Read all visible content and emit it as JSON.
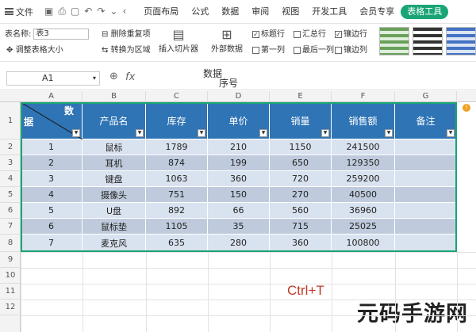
{
  "menubar": {
    "file_label": "文件",
    "tabs": [
      "页面布局",
      "公式",
      "数据",
      "审阅",
      "视图",
      "开发工具",
      "会员专享",
      "表格工具"
    ]
  },
  "ribbon": {
    "table_name_label": "表名称:",
    "table_name_value": "表3",
    "resize_label": "调整表格大小",
    "remove_dup_label": "删除重复项",
    "convert_range_label": "转换为区域",
    "insert_slicer_label": "插入切片器",
    "external_data_label": "外部数据",
    "options": [
      {
        "label": "标题行",
        "checked": true
      },
      {
        "label": "汇总行",
        "checked": false
      },
      {
        "label": "镶边行",
        "checked": true
      },
      {
        "label": "第一列",
        "checked": false
      },
      {
        "label": "最后一列",
        "checked": false
      },
      {
        "label": "镶边列",
        "checked": false
      }
    ]
  },
  "formula_bar": {
    "cell_ref": "A1",
    "fx": "fx",
    "content_line1": "数据",
    "content_line2": "序号"
  },
  "columns": [
    "A",
    "B",
    "C",
    "D",
    "E",
    "F",
    "G"
  ],
  "rows": [
    "1",
    "2",
    "3",
    "4",
    "5",
    "6",
    "7",
    "8",
    "9",
    "10",
    "11",
    "12"
  ],
  "table": {
    "header_a_top": "数",
    "header_a_left": "据",
    "headers": [
      "产品名",
      "库存",
      "单价",
      "销量",
      "销售额",
      "备注"
    ],
    "rows": [
      [
        "1",
        "鼠标",
        "1789",
        "210",
        "1150",
        "241500",
        ""
      ],
      [
        "2",
        "耳机",
        "874",
        "199",
        "650",
        "129350",
        ""
      ],
      [
        "3",
        "键盘",
        "1063",
        "360",
        "720",
        "259200",
        ""
      ],
      [
        "4",
        "摄像头",
        "751",
        "150",
        "270",
        "40500",
        ""
      ],
      [
        "5",
        "U盘",
        "892",
        "66",
        "560",
        "36960",
        ""
      ],
      [
        "6",
        "鼠标垫",
        "1105",
        "35",
        "715",
        "25025",
        ""
      ],
      [
        "7",
        "麦克风",
        "635",
        "280",
        "360",
        "100800",
        ""
      ]
    ]
  },
  "annotation": "Ctrl+T",
  "watermark": "元码手游网",
  "colors": {
    "accent": "#1aa576",
    "header": "#2f74b5",
    "band_light": "#d9e2ef",
    "band_dark": "#bfcbdc",
    "annotation": "#c0392b"
  }
}
